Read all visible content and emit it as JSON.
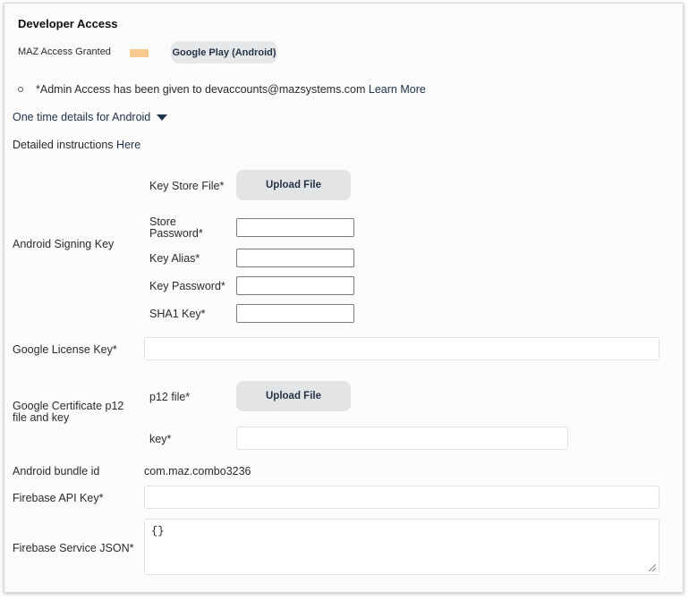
{
  "section": {
    "title": "Developer Access"
  },
  "access": {
    "granted_label": "MAZ Access Granted",
    "platform_pill": "Google Play (Android)",
    "swatch_color": "#f8c98e"
  },
  "admin_notice": {
    "text": "*Admin Access has been given to devaccounts@mazsystems.com",
    "learn_more": "Learn More"
  },
  "android_toggle": {
    "label": "One time details for Android",
    "icon": "caret-down-icon"
  },
  "instructions": {
    "text": "Detailed instructions",
    "link": "Here"
  },
  "signing": {
    "label": "Android Signing Key",
    "key_store_label": "Key Store File*",
    "upload_label": "Upload File",
    "store_password_label": "Store Password*",
    "key_alias_label": "Key Alias*",
    "key_password_label": "Key Password*",
    "sha1_label": "SHA1 Key*"
  },
  "license": {
    "label": "Google License Key*"
  },
  "certificate": {
    "label": "Google Certificate p12 file and key",
    "p12_label": "p12 file*",
    "upload_label": "Upload File",
    "key_label": "key*"
  },
  "bundle": {
    "label": "Android bundle id",
    "value": "com.maz.combo3236"
  },
  "firebase": {
    "api_key_label": "Firebase API Key*",
    "service_json_label": "Firebase Service JSON*",
    "service_json_value": "{}"
  }
}
